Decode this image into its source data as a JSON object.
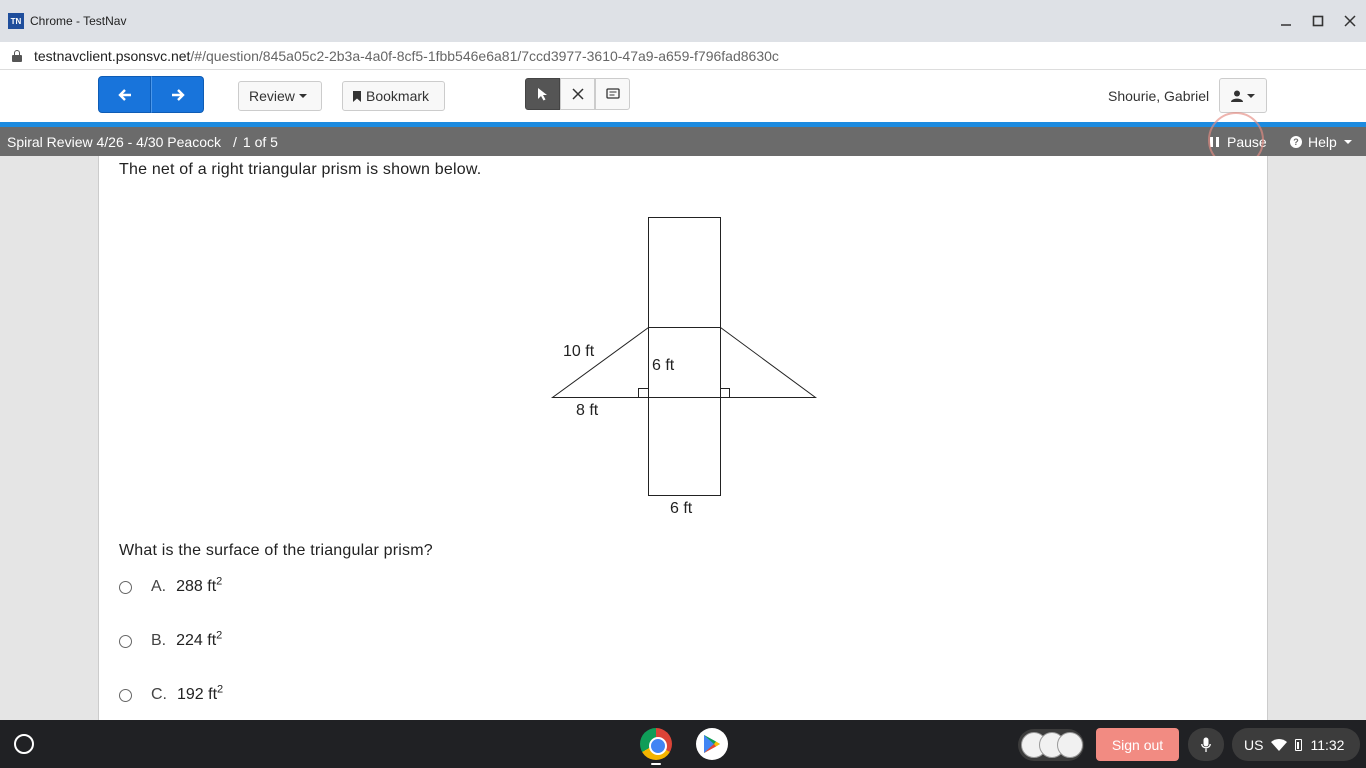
{
  "window": {
    "logo_text": "TN",
    "title": "Chrome - TestNav"
  },
  "address_bar": {
    "host": "testnavclient.psonsvc.net",
    "path": "/#/question/845a05c2-2b3a-4a0f-8cf5-1fbb546e6a81/7ccd3977-3610-47a9-a659-f796fad8630c"
  },
  "toolbar": {
    "review_label": "Review",
    "bookmark_label": "Bookmark",
    "user_name": "Shourie, Gabriel"
  },
  "status": {
    "test_title": "Spiral Review 4/26 - 4/30 Peacock",
    "separator": "/",
    "page_count": "1 of 5",
    "pause_label": "Pause",
    "help_label": "Help"
  },
  "question": {
    "prompt": "The net of a right triangular prism is shown below.",
    "figure_labels": {
      "hypotenuse": "10 ft",
      "height": "6 ft",
      "base": "8 ft",
      "length": "6 ft"
    },
    "text": "What is the surface of the triangular prism?",
    "choices": [
      {
        "letter": "A.",
        "value": "288 ft",
        "exponent": "2"
      },
      {
        "letter": "B.",
        "value": "224 ft",
        "exponent": "2"
      },
      {
        "letter": "C.",
        "value": "192 ft",
        "exponent": "2"
      }
    ]
  },
  "taskbar": {
    "signout_label": "Sign out",
    "keyboard_layout": "US",
    "clock": "11:32"
  },
  "colors": {
    "nav_blue": "#1874db",
    "accent_rule": "#1c8be0",
    "status_bar": "#6b6b6b",
    "signout": "#f28b82"
  }
}
